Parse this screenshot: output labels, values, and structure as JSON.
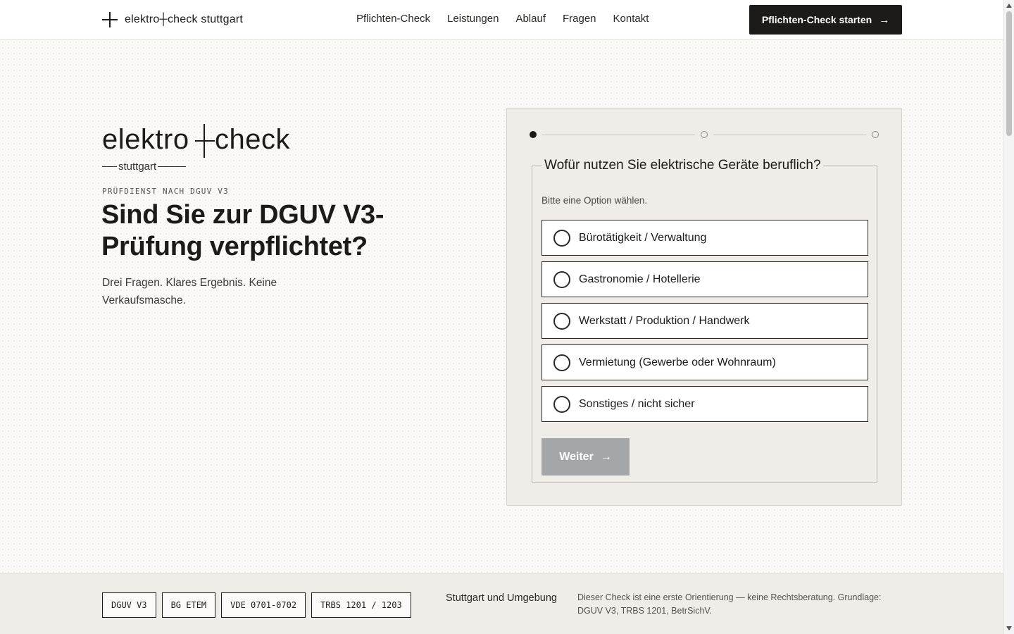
{
  "header": {
    "brand": "elektro┼check stuttgart",
    "nav": [
      "Pflichten-Check",
      "Leistungen",
      "Ablauf",
      "Fragen",
      "Kontakt"
    ],
    "cta_label": "Pflichten-Check starten",
    "cta_arrow": "→"
  },
  "hero": {
    "logo_word_left": "elektro",
    "logo_word_right": "check",
    "logo_sub": "stuttgart",
    "eyebrow": "PRÜFDIENST NACH DGUV V3",
    "title": "Sind Sie zur DGUV V3-Prüfung verpflichtet?",
    "lead": "Drei Fragen. Klares Ergebnis. Keine Verkaufsmasche."
  },
  "quiz": {
    "progress": {
      "current_step": 1,
      "total_steps": 3
    },
    "question": "Wofür nutzen Sie elektrische Geräte beruflich?",
    "hint": "Bitte eine Option wählen.",
    "options": [
      {
        "label": "Bürotätigkeit / Verwaltung",
        "selected": false
      },
      {
        "label": "Gastronomie / Hotellerie",
        "selected": false
      },
      {
        "label": "Werkstatt / Produktion / Handwerk",
        "selected": false
      },
      {
        "label": "Vermietung (Gewerbe oder Wohnraum)",
        "selected": false
      },
      {
        "label": "Sonstiges / nicht sicher",
        "selected": false
      }
    ],
    "next_label": "Weiter",
    "next_arrow": "→",
    "next_disabled": true
  },
  "footer": {
    "tags": [
      "DGUV V3",
      "BG ETEM",
      "VDE 0701-0702",
      "TRBS 1201 / 1203"
    ],
    "region": "Stuttgart und Umgebung",
    "disclaimer": "Dieser Check ist eine erste Orientierung — keine Rechtsberatung. Grundlage: DGUV V3, TRBS 1201, BetrSichV."
  },
  "icons": {
    "brand": "plus-cross-icon",
    "arrow": "arrow-right-icon",
    "radio": "radio-empty-icon"
  },
  "colors": {
    "ink": "#1c1b19",
    "card_bg": "#f0ede8",
    "button_disabled": "#a4a6a8",
    "page_bg": "#faf9f7"
  }
}
